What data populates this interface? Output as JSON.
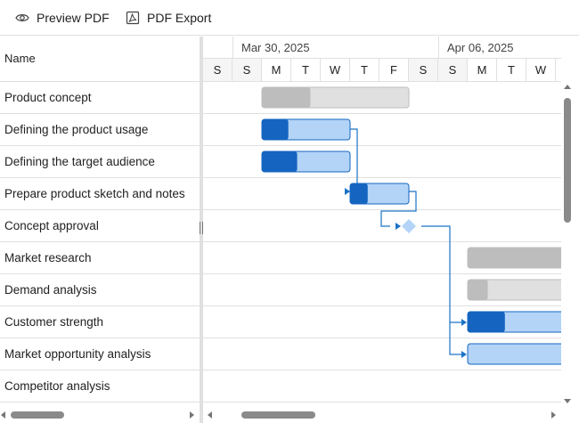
{
  "toolbar": {
    "preview_label": "Preview PDF",
    "export_label": "PDF Export"
  },
  "grid": {
    "header": "Name",
    "rows": [
      "Product concept",
      "Defining the product usage",
      "Defining the target audience",
      "Prepare product sketch and notes",
      "Concept approval",
      "Market research",
      "Demand analysis",
      "Customer strength",
      "Market opportunity analysis",
      "Competitor analysis"
    ]
  },
  "timeline": {
    "weeks": [
      "Mar 30, 2025",
      "Apr 06, 2025"
    ],
    "days": [
      "S",
      "S",
      "M",
      "T",
      "W",
      "T",
      "F",
      "S",
      "S",
      "M",
      "T",
      "W"
    ]
  },
  "tasks": [
    {
      "name": "Product concept",
      "kind": "parent",
      "progress": 0.33
    },
    {
      "name": "Defining the product usage",
      "kind": "child",
      "progress": 0.3
    },
    {
      "name": "Defining the target audience",
      "kind": "child",
      "progress": 0.4
    },
    {
      "name": "Prepare product sketch and notes",
      "kind": "child",
      "progress": 0.3
    },
    {
      "name": "Concept approval",
      "kind": "milestone"
    },
    {
      "name": "Market research",
      "kind": "parent",
      "progress": 0.95
    },
    {
      "name": "Demand analysis",
      "kind": "parent",
      "progress": 0.2
    },
    {
      "name": "Customer strength",
      "kind": "child",
      "progress": 0.37
    },
    {
      "name": "Market opportunity analysis",
      "kind": "child",
      "progress": 0
    },
    {
      "name": "Competitor analysis",
      "kind": "none"
    }
  ],
  "colors": {
    "accent": "#1a73c8",
    "task_fill": "#b3d4f7",
    "task_progress": "#1565c0",
    "parent_fill": "#e0e0e0",
    "parent_progress": "#bdbdbd",
    "connector": "#1a73c8",
    "weekend": "#f5f5f5",
    "border": "#e0e0e0"
  },
  "icons": {
    "preview": "eye-icon",
    "export": "pdf-icon"
  }
}
